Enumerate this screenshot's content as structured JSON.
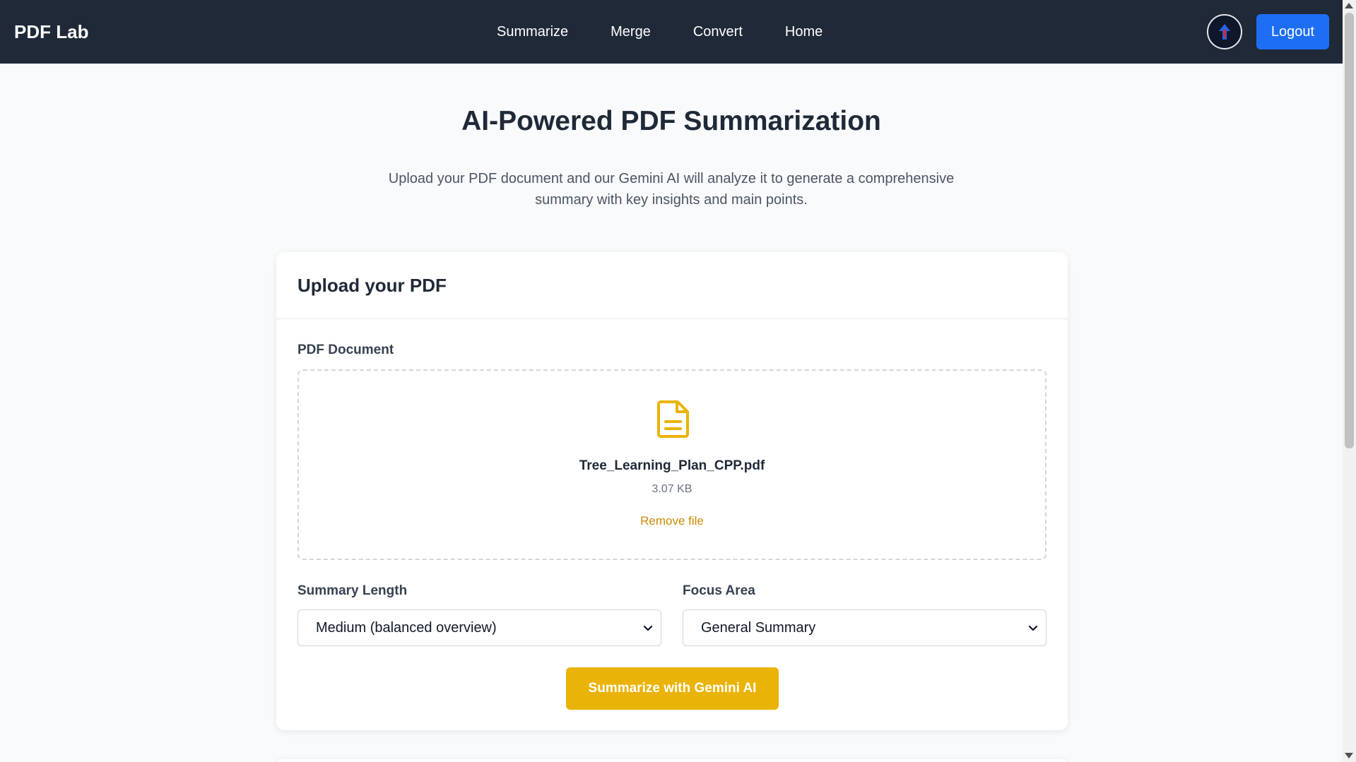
{
  "nav": {
    "brand": "PDF Lab",
    "links": [
      "Summarize",
      "Merge",
      "Convert",
      "Home"
    ],
    "logout_label": "Logout"
  },
  "hero": {
    "title": "AI-Powered PDF Summarization",
    "description": "Upload your PDF document and our Gemini AI will analyze it to generate a comprehensive summary with key insights and main points."
  },
  "upload_card": {
    "title": "Upload your PDF",
    "document_label": "PDF Document",
    "file": {
      "name": "Tree_Learning_Plan_CPP.pdf",
      "size": "3.07 KB",
      "remove_label": "Remove file"
    },
    "summary_length": {
      "label": "Summary Length",
      "selected": "Medium (balanced overview)"
    },
    "focus_area": {
      "label": "Focus Area",
      "selected": "General Summary"
    },
    "submit_label": "Summarize with Gemini AI"
  },
  "colors": {
    "navbar": "#1f2937",
    "primary_blue": "#1d6ef5",
    "accent_yellow": "#eab308",
    "remove_link": "#ca8a04"
  }
}
